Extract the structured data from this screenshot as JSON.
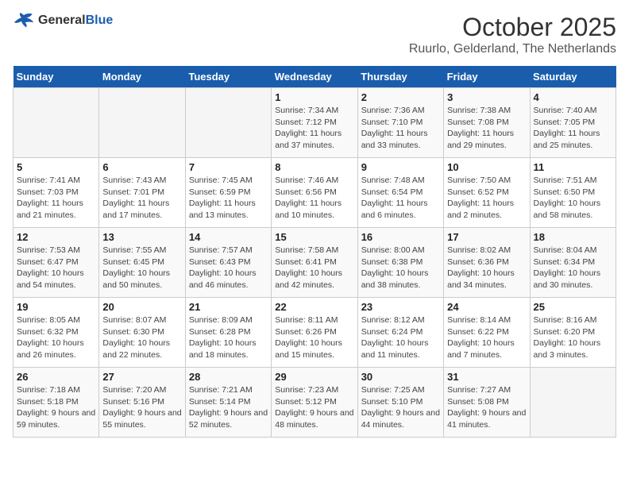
{
  "header": {
    "logo": {
      "general": "General",
      "blue": "Blue"
    },
    "title": "October 2025",
    "subtitle": "Ruurlo, Gelderland, The Netherlands"
  },
  "weekdays": [
    "Sunday",
    "Monday",
    "Tuesday",
    "Wednesday",
    "Thursday",
    "Friday",
    "Saturday"
  ],
  "weeks": [
    [
      {
        "day": "",
        "detail": ""
      },
      {
        "day": "",
        "detail": ""
      },
      {
        "day": "",
        "detail": ""
      },
      {
        "day": "1",
        "detail": "Sunrise: 7:34 AM\nSunset: 7:12 PM\nDaylight: 11 hours and 37 minutes."
      },
      {
        "day": "2",
        "detail": "Sunrise: 7:36 AM\nSunset: 7:10 PM\nDaylight: 11 hours and 33 minutes."
      },
      {
        "day": "3",
        "detail": "Sunrise: 7:38 AM\nSunset: 7:08 PM\nDaylight: 11 hours and 29 minutes."
      },
      {
        "day": "4",
        "detail": "Sunrise: 7:40 AM\nSunset: 7:05 PM\nDaylight: 11 hours and 25 minutes."
      }
    ],
    [
      {
        "day": "5",
        "detail": "Sunrise: 7:41 AM\nSunset: 7:03 PM\nDaylight: 11 hours and 21 minutes."
      },
      {
        "day": "6",
        "detail": "Sunrise: 7:43 AM\nSunset: 7:01 PM\nDaylight: 11 hours and 17 minutes."
      },
      {
        "day": "7",
        "detail": "Sunrise: 7:45 AM\nSunset: 6:59 PM\nDaylight: 11 hours and 13 minutes."
      },
      {
        "day": "8",
        "detail": "Sunrise: 7:46 AM\nSunset: 6:56 PM\nDaylight: 11 hours and 10 minutes."
      },
      {
        "day": "9",
        "detail": "Sunrise: 7:48 AM\nSunset: 6:54 PM\nDaylight: 11 hours and 6 minutes."
      },
      {
        "day": "10",
        "detail": "Sunrise: 7:50 AM\nSunset: 6:52 PM\nDaylight: 11 hours and 2 minutes."
      },
      {
        "day": "11",
        "detail": "Sunrise: 7:51 AM\nSunset: 6:50 PM\nDaylight: 10 hours and 58 minutes."
      }
    ],
    [
      {
        "day": "12",
        "detail": "Sunrise: 7:53 AM\nSunset: 6:47 PM\nDaylight: 10 hours and 54 minutes."
      },
      {
        "day": "13",
        "detail": "Sunrise: 7:55 AM\nSunset: 6:45 PM\nDaylight: 10 hours and 50 minutes."
      },
      {
        "day": "14",
        "detail": "Sunrise: 7:57 AM\nSunset: 6:43 PM\nDaylight: 10 hours and 46 minutes."
      },
      {
        "day": "15",
        "detail": "Sunrise: 7:58 AM\nSunset: 6:41 PM\nDaylight: 10 hours and 42 minutes."
      },
      {
        "day": "16",
        "detail": "Sunrise: 8:00 AM\nSunset: 6:38 PM\nDaylight: 10 hours and 38 minutes."
      },
      {
        "day": "17",
        "detail": "Sunrise: 8:02 AM\nSunset: 6:36 PM\nDaylight: 10 hours and 34 minutes."
      },
      {
        "day": "18",
        "detail": "Sunrise: 8:04 AM\nSunset: 6:34 PM\nDaylight: 10 hours and 30 minutes."
      }
    ],
    [
      {
        "day": "19",
        "detail": "Sunrise: 8:05 AM\nSunset: 6:32 PM\nDaylight: 10 hours and 26 minutes."
      },
      {
        "day": "20",
        "detail": "Sunrise: 8:07 AM\nSunset: 6:30 PM\nDaylight: 10 hours and 22 minutes."
      },
      {
        "day": "21",
        "detail": "Sunrise: 8:09 AM\nSunset: 6:28 PM\nDaylight: 10 hours and 18 minutes."
      },
      {
        "day": "22",
        "detail": "Sunrise: 8:11 AM\nSunset: 6:26 PM\nDaylight: 10 hours and 15 minutes."
      },
      {
        "day": "23",
        "detail": "Sunrise: 8:12 AM\nSunset: 6:24 PM\nDaylight: 10 hours and 11 minutes."
      },
      {
        "day": "24",
        "detail": "Sunrise: 8:14 AM\nSunset: 6:22 PM\nDaylight: 10 hours and 7 minutes."
      },
      {
        "day": "25",
        "detail": "Sunrise: 8:16 AM\nSunset: 6:20 PM\nDaylight: 10 hours and 3 minutes."
      }
    ],
    [
      {
        "day": "26",
        "detail": "Sunrise: 7:18 AM\nSunset: 5:18 PM\nDaylight: 9 hours and 59 minutes."
      },
      {
        "day": "27",
        "detail": "Sunrise: 7:20 AM\nSunset: 5:16 PM\nDaylight: 9 hours and 55 minutes."
      },
      {
        "day": "28",
        "detail": "Sunrise: 7:21 AM\nSunset: 5:14 PM\nDaylight: 9 hours and 52 minutes."
      },
      {
        "day": "29",
        "detail": "Sunrise: 7:23 AM\nSunset: 5:12 PM\nDaylight: 9 hours and 48 minutes."
      },
      {
        "day": "30",
        "detail": "Sunrise: 7:25 AM\nSunset: 5:10 PM\nDaylight: 9 hours and 44 minutes."
      },
      {
        "day": "31",
        "detail": "Sunrise: 7:27 AM\nSunset: 5:08 PM\nDaylight: 9 hours and 41 minutes."
      },
      {
        "day": "",
        "detail": ""
      }
    ]
  ]
}
